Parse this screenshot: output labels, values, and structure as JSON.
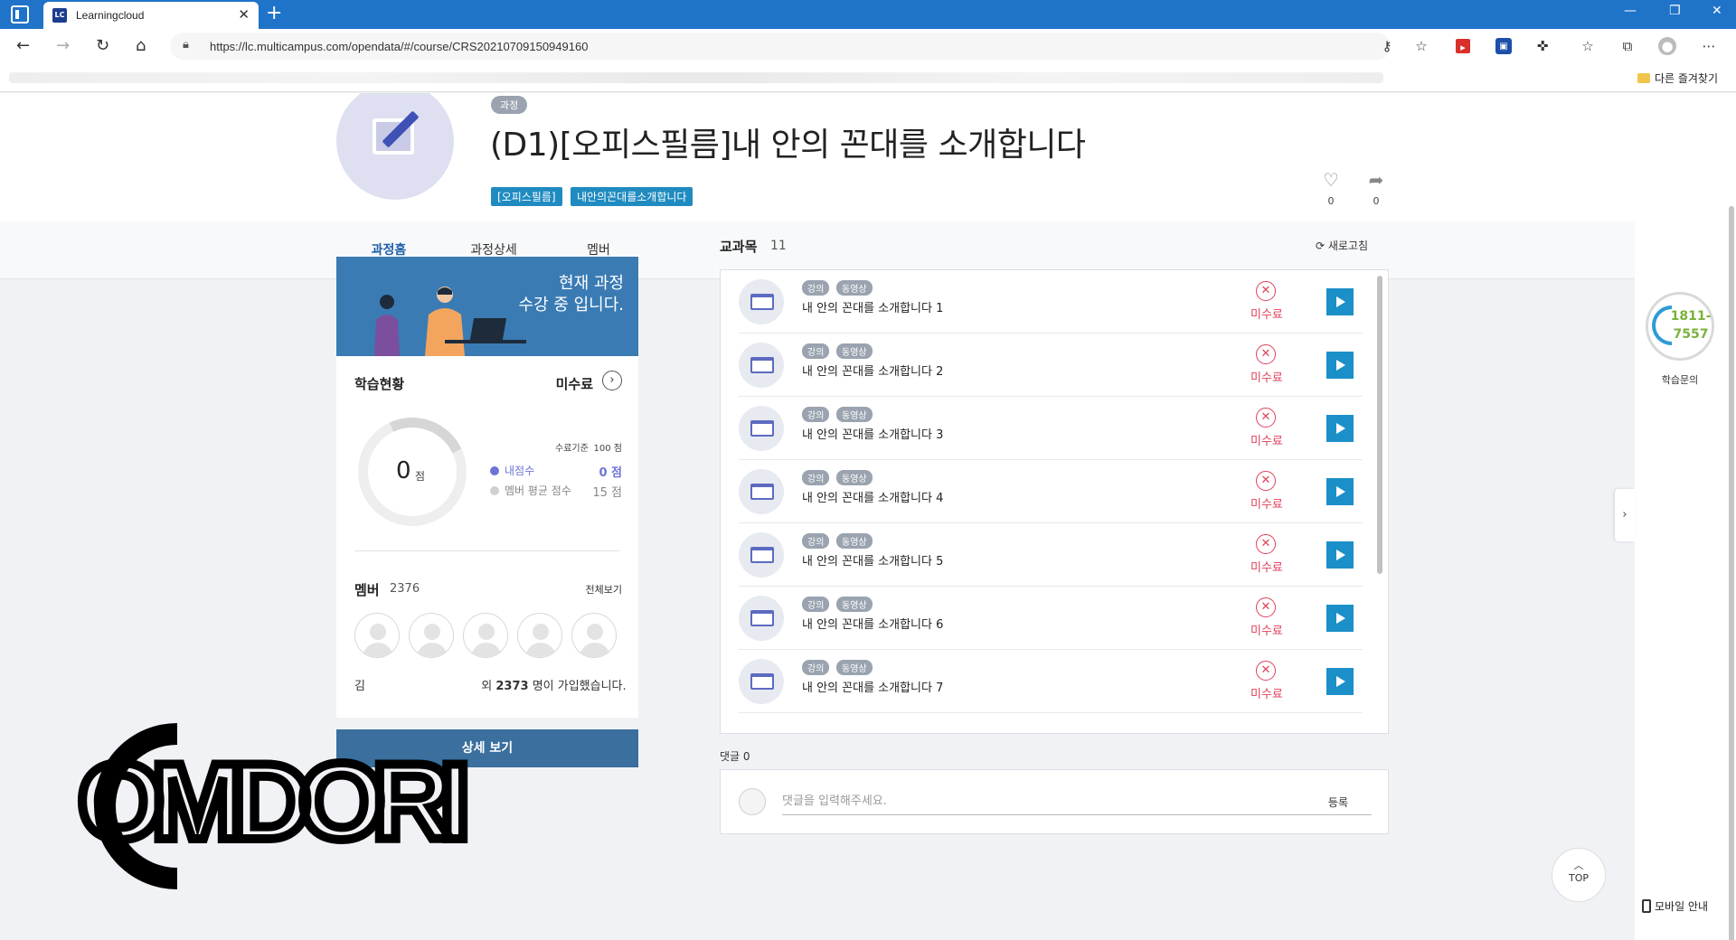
{
  "browser": {
    "tab_title": "Learningcloud",
    "tab_favicon": "LC",
    "url": "https://lc.multicampus.com/opendata/#/course/CRS20210709150949160",
    "favorites_folder": "다른 즐겨찾기"
  },
  "course": {
    "type_badge": "과정",
    "title": "(D1)[오피스필름]내 안의 꼰대를 소개합니다",
    "tags": [
      "[오피스필름]",
      "내안의꼰대를소개합니다"
    ],
    "likes": "0",
    "shares": "0"
  },
  "tabs": [
    "과정홈",
    "과정상세",
    "멤버"
  ],
  "status_card": {
    "banner_line1": "현재 과정",
    "banner_line2": "수강 중 입니다.",
    "title": "학습현황",
    "status": "미수료",
    "score": "0",
    "score_unit": "점",
    "criteria_label": "수료기준",
    "criteria_value": "100 점",
    "my_score_label": "내점수",
    "my_score_value": "0 점",
    "avg_score_label": "멤버 평균 점수",
    "avg_score_value": "15 점",
    "member_title": "멤버",
    "member_count": "2376",
    "view_all": "전체보기",
    "join_text_prefix": "김",
    "join_text_middle": "외",
    "join_count": "2373",
    "join_text_suffix": "명이 가입했습니다.",
    "detail_button": "상세 보기"
  },
  "subjects": {
    "title": "교과목",
    "count": "11",
    "refresh": "새로고침",
    "badge_type": "강의",
    "badge_media": "동영상",
    "items": [
      {
        "title": "내 안의 꼰대를 소개합니다 1",
        "status": "미수료"
      },
      {
        "title": "내 안의 꼰대를 소개합니다 2",
        "status": "미수료"
      },
      {
        "title": "내 안의 꼰대를 소개합니다 3",
        "status": "미수료"
      },
      {
        "title": "내 안의 꼰대를 소개합니다 4",
        "status": "미수료"
      },
      {
        "title": "내 안의 꼰대를 소개합니다 5",
        "status": "미수료"
      },
      {
        "title": "내 안의 꼰대를 소개합니다 6",
        "status": "미수료"
      },
      {
        "title": "내 안의 꼰대를 소개합니다 7",
        "status": "미수료"
      }
    ]
  },
  "comments": {
    "label": "댓글 0",
    "placeholder": "댓글을 입력해주세요.",
    "submit": "등록"
  },
  "side": {
    "phone_line1": "1811-",
    "phone_line2": "7557",
    "help_label": "학습문의",
    "top": "TOP",
    "mobile": "모바일 안내"
  },
  "watermark_text": "COMDORI",
  "colors": {
    "browser_accent": "#1f73c8",
    "primary": "#1f5fa8",
    "tag_blue": "#1f8bc0",
    "banner_blue": "#3a7bb4",
    "incomplete_red": "#e0405a",
    "play_blue": "#1b8fc8",
    "my_score_purple": "#6c75d6"
  }
}
